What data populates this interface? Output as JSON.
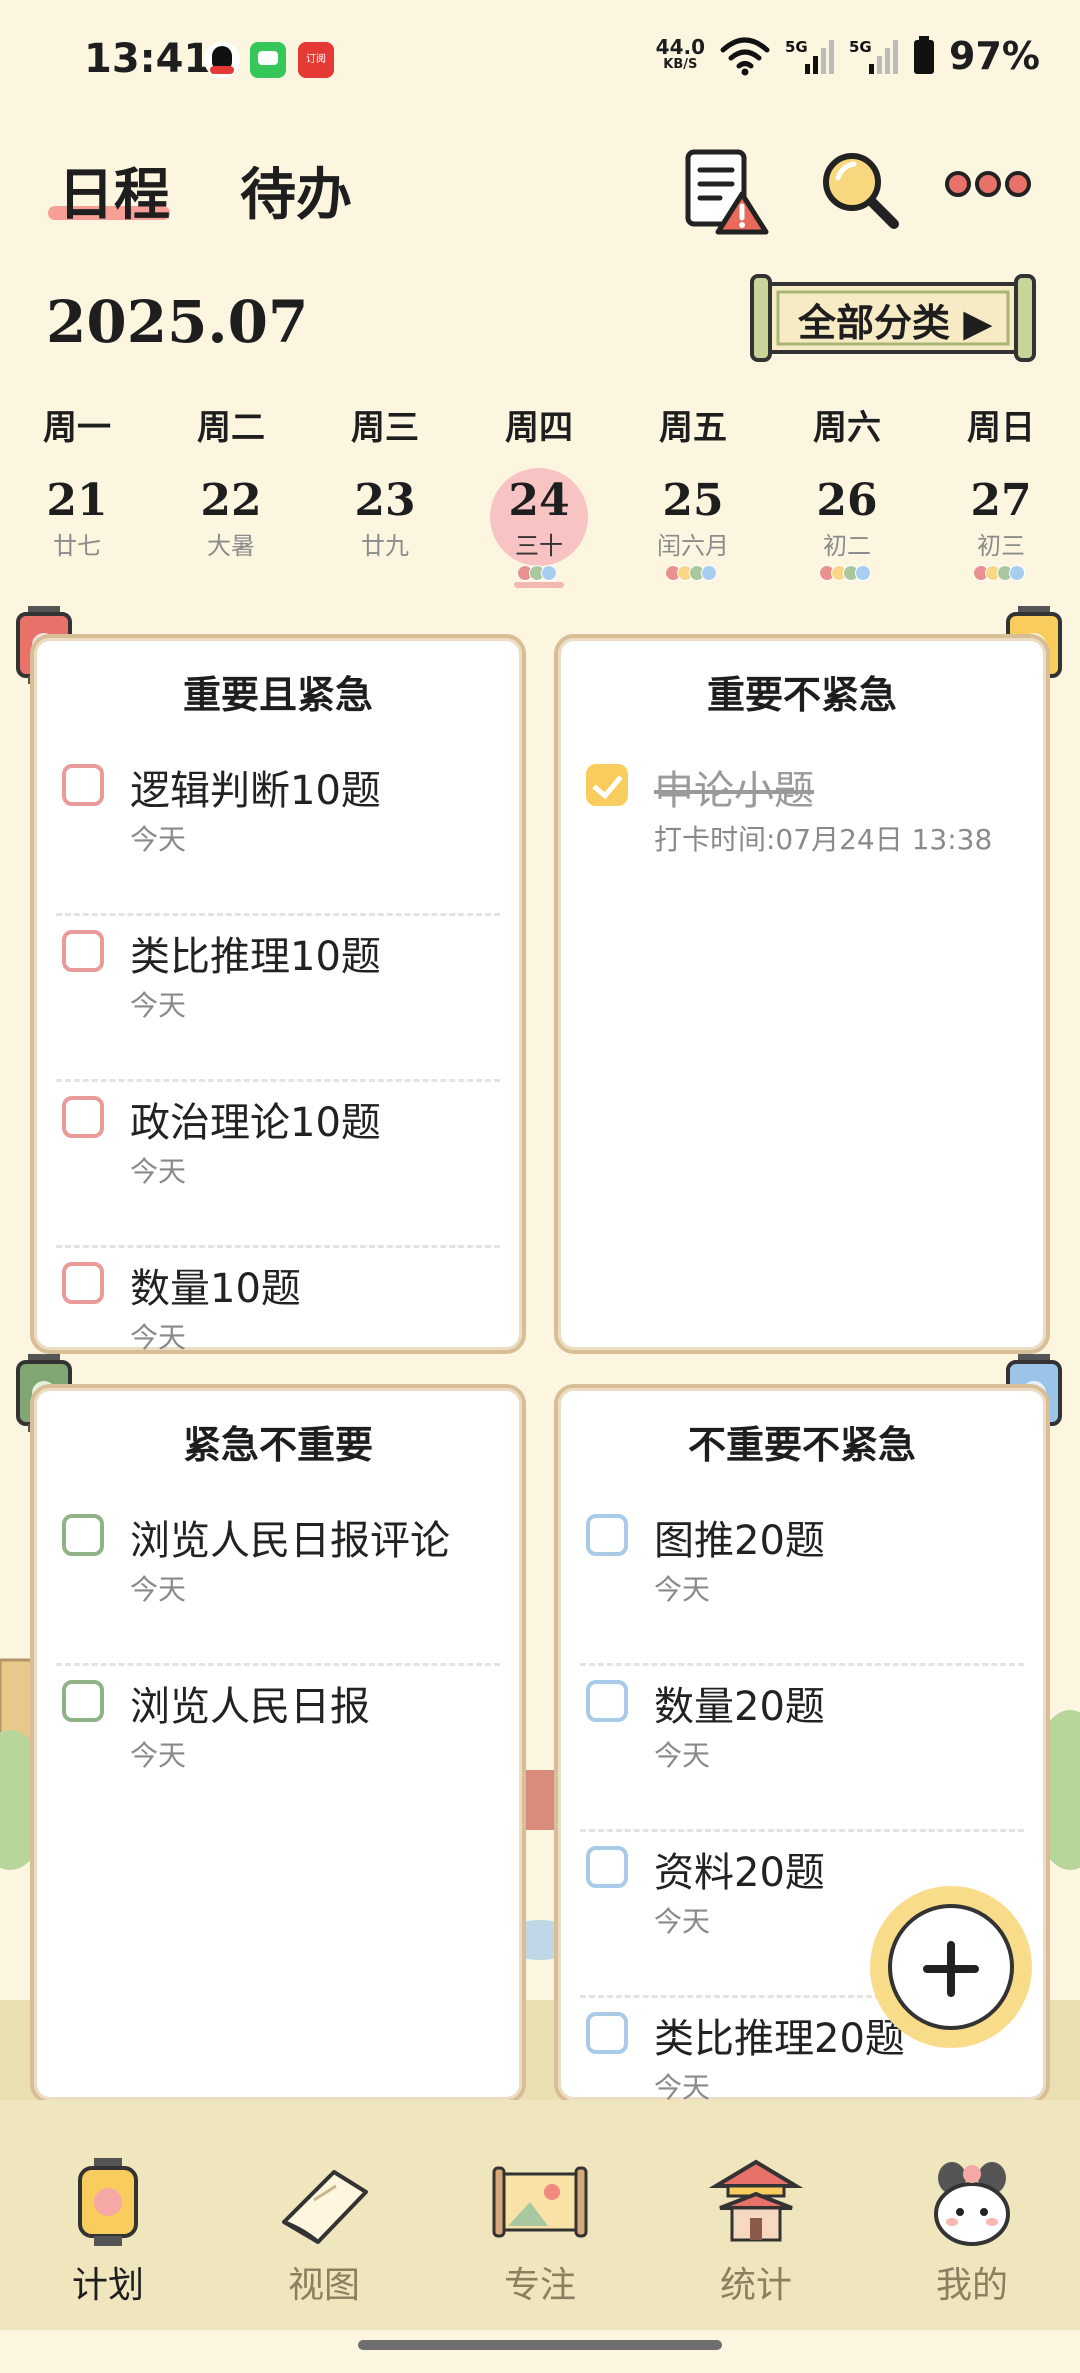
{
  "status_bar": {
    "time": "13:41",
    "speed_value": "44.0",
    "speed_unit": "KB/S",
    "network_1": "5G",
    "network_2": "5G",
    "battery": "97%",
    "news_app_text": "订阅"
  },
  "header": {
    "tab_schedule": "日程",
    "tab_todo": "待办",
    "icons": [
      "notes-warning-icon",
      "search-icon",
      "more-icon"
    ]
  },
  "month": "2025.07",
  "category_button": "全部分类 ▶",
  "week": [
    {
      "weekday": "周一",
      "day": "21",
      "lunar": "廿七",
      "dots": []
    },
    {
      "weekday": "周二",
      "day": "22",
      "lunar": "大暑",
      "dots": []
    },
    {
      "weekday": "周三",
      "day": "23",
      "lunar": "廿九",
      "dots": []
    },
    {
      "weekday": "周四",
      "day": "24",
      "lunar": "三十",
      "dots": [
        "#E8918E",
        "#A9C8A0",
        "#A8CDEE"
      ],
      "active": true
    },
    {
      "weekday": "周五",
      "day": "25",
      "lunar": "闰六月",
      "dots": [
        "#E8918E",
        "#F8D888",
        "#A9C8A0",
        "#A8CDEE"
      ]
    },
    {
      "weekday": "周六",
      "day": "26",
      "lunar": "初二",
      "dots": [
        "#E8918E",
        "#F8D888",
        "#A9C8A0",
        "#A8CDEE"
      ]
    },
    {
      "weekday": "周日",
      "day": "27",
      "lunar": "初三",
      "dots": [
        "#E8918E",
        "#F8D888",
        "#A9C8A0",
        "#A8CDEE"
      ]
    }
  ],
  "quadrants": {
    "q1": {
      "title": "重要且紧急",
      "tasks": [
        {
          "title": "逻辑判断10题",
          "sub": "今天"
        },
        {
          "title": "类比推理10题",
          "sub": "今天"
        },
        {
          "title": "政治理论10题",
          "sub": "今天"
        },
        {
          "title": "数量10题",
          "sub": "今天"
        }
      ]
    },
    "q2": {
      "title": "重要不紧急",
      "tasks": [
        {
          "title": "申论小题",
          "sub": "打卡时间:07月24日 13:38",
          "done": true
        }
      ]
    },
    "q3": {
      "title": "紧急不重要",
      "tasks": [
        {
          "title": "浏览人民日报评论",
          "sub": "今天"
        },
        {
          "title": "浏览人民日报",
          "sub": "今天"
        }
      ]
    },
    "q4": {
      "title": "不重要不紧急",
      "tasks": [
        {
          "title": "图推20题",
          "sub": "今天"
        },
        {
          "title": "数量20题",
          "sub": "今天"
        },
        {
          "title": "资料20题",
          "sub": "今天"
        },
        {
          "title": "类比推理20题",
          "sub": "今天"
        }
      ]
    }
  },
  "nav": [
    {
      "label": "计划",
      "icon": "lantern-icon",
      "active": true
    },
    {
      "label": "视图",
      "icon": "book-icon"
    },
    {
      "label": "专注",
      "icon": "scroll-painting-icon"
    },
    {
      "label": "统计",
      "icon": "pavilion-icon"
    },
    {
      "label": "我的",
      "icon": "bunny-avatar-icon"
    }
  ],
  "colors": {
    "background": "#FCF6E1",
    "card_border": "#D7BE97",
    "q1_accent": "#E89B98",
    "q2_accent": "#F8CD5E",
    "q3_accent": "#8FB386",
    "q4_accent": "#A9CBE8",
    "nav_bg": "#EFE6BE"
  }
}
